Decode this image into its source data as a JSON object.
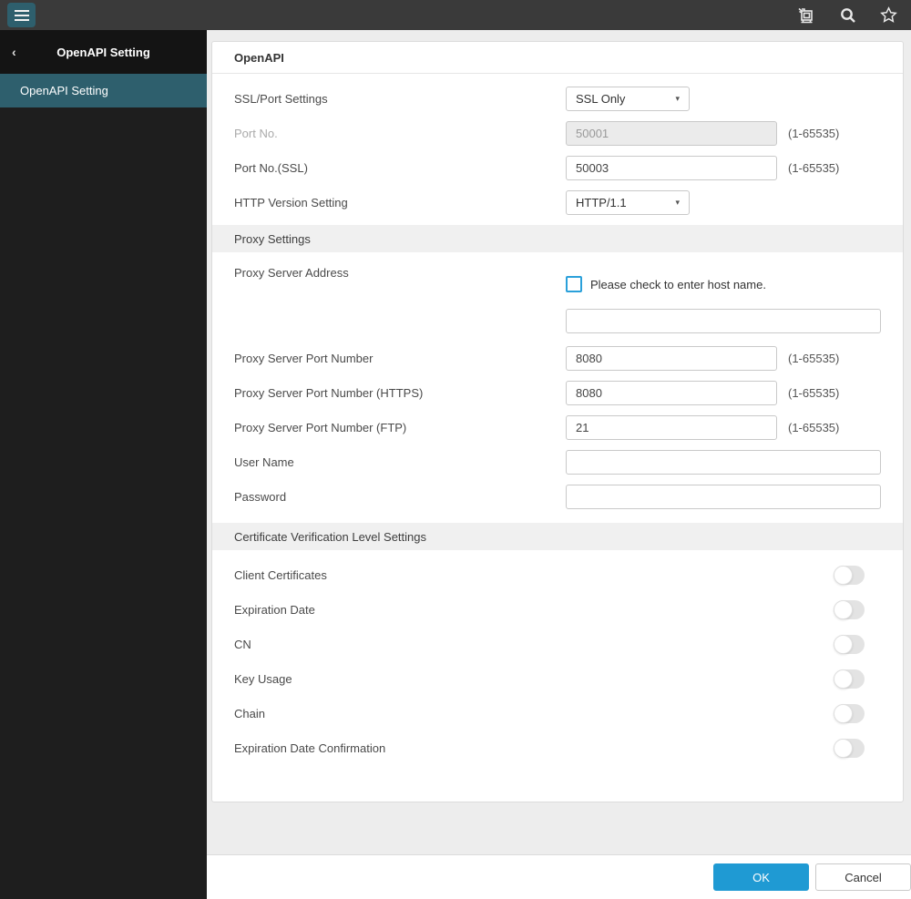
{
  "colors": {
    "accent_blue": "#1f9ad3",
    "teal": "#2e5f6d",
    "topbar_bg": "#3a3a3a",
    "sidebar_bg": "#1e1e1e",
    "section_bar_bg": "#f0f0f0",
    "disabled_input_bg": "#ebebeb"
  },
  "topbar": {
    "icons": {
      "menu": "hamburger",
      "device": "printer",
      "search": "magnifier",
      "favorite": "star-outline"
    }
  },
  "sidebar": {
    "back_icon": "chevron-left",
    "back_glyph": "‹",
    "title": "OpenAPI Setting",
    "items": [
      {
        "label": "OpenAPI Setting",
        "selected": true
      }
    ]
  },
  "panel": {
    "title": "OpenAPI"
  },
  "form": {
    "ssl_port": {
      "label": "SSL/Port Settings",
      "value": "SSL Only",
      "control": "dropdown",
      "caret": "▾"
    },
    "port_no": {
      "label": "Port No.",
      "value": "50001",
      "hint": "(1-65535)",
      "disabled": true
    },
    "port_ssl": {
      "label": "Port No.(SSL)",
      "value": "50003",
      "hint": "(1-65535)"
    },
    "http_version": {
      "label": "HTTP Version Setting",
      "value": "HTTP/1.1",
      "control": "dropdown",
      "caret": "▾"
    },
    "proxy": {
      "section_title": "Proxy Settings",
      "address": {
        "label": "Proxy Server Address",
        "checkbox_label": "Please check to enter host name.",
        "checked": false,
        "value": ""
      },
      "port": {
        "label": "Proxy Server Port Number",
        "value": "8080",
        "hint": "(1-65535)"
      },
      "port_https": {
        "label": "Proxy Server Port Number (HTTPS)",
        "value": "8080",
        "hint": "(1-65535)"
      },
      "port_ftp": {
        "label": "Proxy Server Port Number (FTP)",
        "value": "21",
        "hint": "(1-65535)"
      },
      "user_name": {
        "label": "User Name",
        "value": ""
      },
      "password": {
        "label": "Password",
        "value": ""
      }
    },
    "certificate": {
      "section_title": "Certificate Verification Level Settings",
      "toggles": [
        {
          "label": "Client Certificates",
          "on": false
        },
        {
          "label": "Expiration Date",
          "on": false
        },
        {
          "label": "CN",
          "on": false
        },
        {
          "label": "Key Usage",
          "on": false
        },
        {
          "label": "Chain",
          "on": false
        },
        {
          "label": "Expiration Date Confirmation",
          "on": false
        }
      ]
    }
  },
  "footer": {
    "ok_label": "OK",
    "cancel_label": "Cancel"
  }
}
